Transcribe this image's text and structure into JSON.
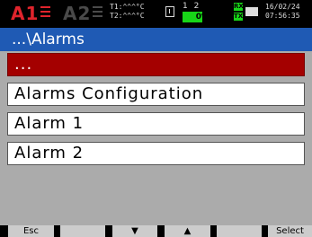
{
  "status": {
    "alarm1": "A1",
    "alarm2": "A2",
    "temp1": "T1:^^^°C",
    "temp2": "T2:^^^°C",
    "channels": "1 2",
    "storage_percent": "0%",
    "storage_fraction": 0.65,
    "rx": "RX",
    "tx": "TX",
    "date": "16/02/24",
    "time": "07:56:35",
    "colors": {
      "alarm_active": "#e0242c",
      "progress": "#18d618"
    }
  },
  "title": "...\\Alarms",
  "menu": {
    "items": [
      "...",
      "Alarms Configuration",
      "Alarm 1",
      "Alarm 2"
    ],
    "selected_index": 0
  },
  "softkeys": [
    "Esc",
    "",
    "▼",
    "▲",
    "",
    "Select"
  ]
}
